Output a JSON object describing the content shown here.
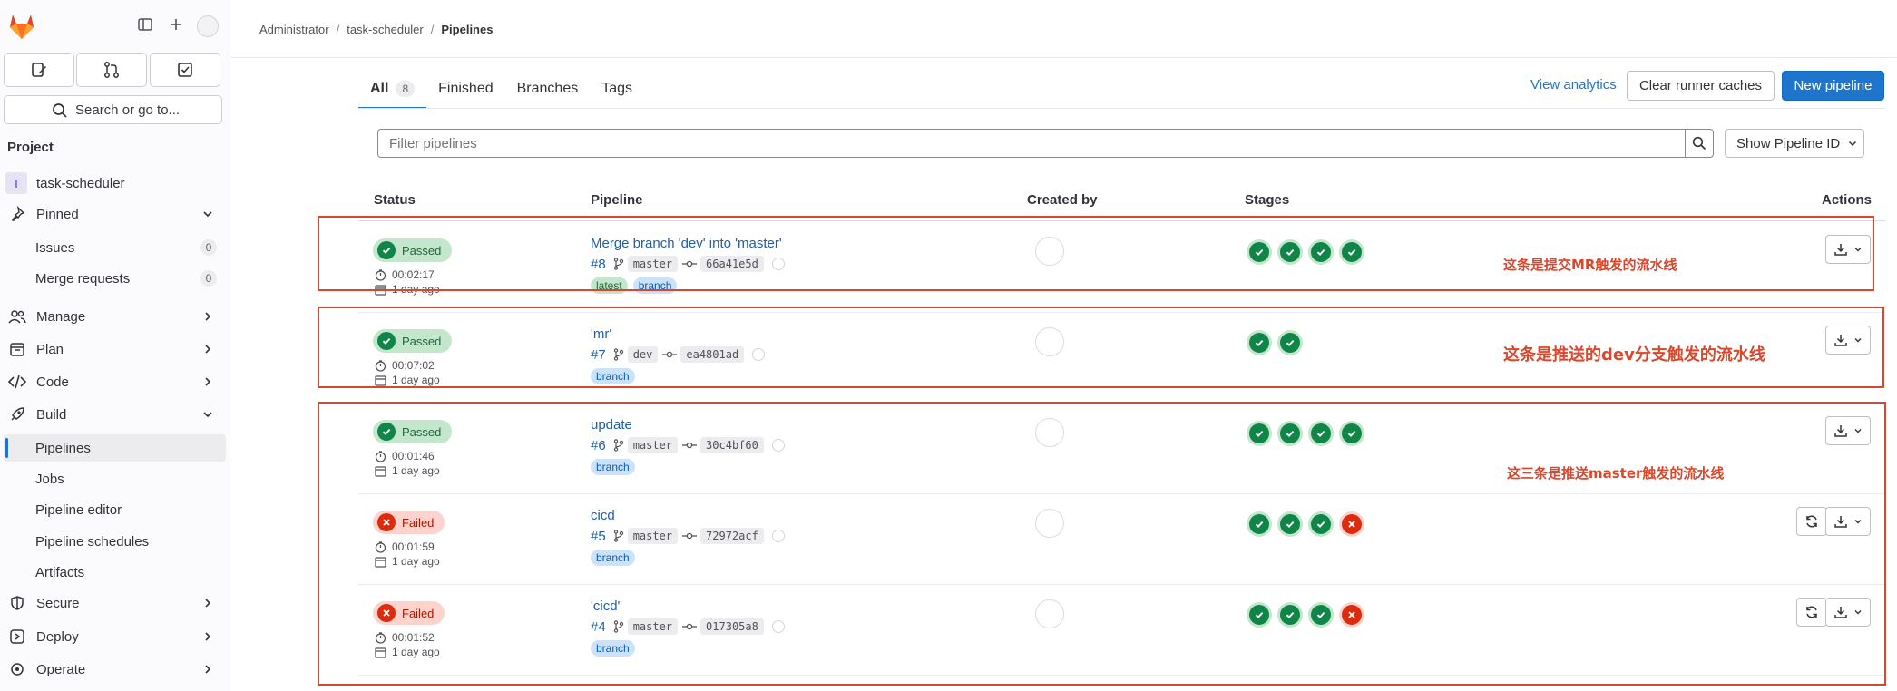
{
  "sidebar": {
    "search_placeholder": "Search or go to...",
    "section_title": "Project",
    "project": {
      "initial": "T",
      "name": "task-scheduler"
    },
    "pinned_label": "Pinned",
    "pinned_items": [
      {
        "label": "Issues",
        "count": "0"
      },
      {
        "label": "Merge requests",
        "count": "0"
      }
    ],
    "manage_label": "Manage",
    "plan_label": "Plan",
    "code_label": "Code",
    "build_label": "Build",
    "build_items": [
      "Pipelines",
      "Jobs",
      "Pipeline editor",
      "Pipeline schedules",
      "Artifacts"
    ],
    "secure_label": "Secure",
    "deploy_label": "Deploy",
    "operate_label": "Operate"
  },
  "breadcrumb": [
    "Administrator",
    "task-scheduler",
    "Pipelines"
  ],
  "tabs": [
    {
      "label": "All",
      "count": "8"
    },
    {
      "label": "Finished"
    },
    {
      "label": "Branches"
    },
    {
      "label": "Tags"
    }
  ],
  "header_actions": {
    "analytics": "View analytics",
    "clear_caches": "Clear runner caches",
    "new_pipeline": "New pipeline"
  },
  "filter": {
    "placeholder": "Filter pipelines",
    "show_id": "Show Pipeline ID"
  },
  "table": {
    "headers": [
      "Status",
      "Pipeline",
      "Created by",
      "Stages",
      "Actions"
    ],
    "rows": [
      {
        "status": "Passed",
        "duration": "00:02:17",
        "finished": "1 day ago",
        "title": "Merge branch 'dev' into 'master'",
        "id": "#8",
        "ref": "master",
        "commit": "66a41e5d",
        "tags": [
          "latest",
          "branch"
        ],
        "stages": [
          "success",
          "success",
          "success",
          "success"
        ]
      },
      {
        "status": "Passed",
        "duration": "00:07:02",
        "finished": "1 day ago",
        "title": "'mr'",
        "id": "#7",
        "ref": "dev",
        "commit": "ea4801ad",
        "tags": [
          "branch"
        ],
        "stages": [
          "success",
          "success"
        ]
      },
      {
        "status": "Passed",
        "duration": "00:01:46",
        "finished": "1 day ago",
        "title": "update",
        "id": "#6",
        "ref": "master",
        "commit": "30c4bf60",
        "tags": [
          "branch"
        ],
        "stages": [
          "success",
          "success",
          "success",
          "success"
        ]
      },
      {
        "status": "Failed",
        "duration": "00:01:59",
        "finished": "1 day ago",
        "title": "cicd",
        "id": "#5",
        "ref": "master",
        "commit": "72972acf",
        "tags": [
          "branch"
        ],
        "stages": [
          "success",
          "success",
          "success",
          "failed"
        ]
      },
      {
        "status": "Failed",
        "duration": "00:01:52",
        "finished": "1 day ago",
        "title": "'cicd'",
        "id": "#4",
        "ref": "master",
        "commit": "017305a8",
        "tags": [
          "branch"
        ],
        "stages": [
          "success",
          "success",
          "success",
          "failed"
        ]
      }
    ]
  },
  "annotations": {
    "mr": "这条是提交MR触发的流水线",
    "dev": "这条是推送的dev分支触发的流水线",
    "master": "这三条是推送master触发的流水线",
    "color": "#d9472c"
  },
  "colors": {
    "accent": "#1f75cb",
    "success": "#108548",
    "danger": "#dd2b0e"
  }
}
